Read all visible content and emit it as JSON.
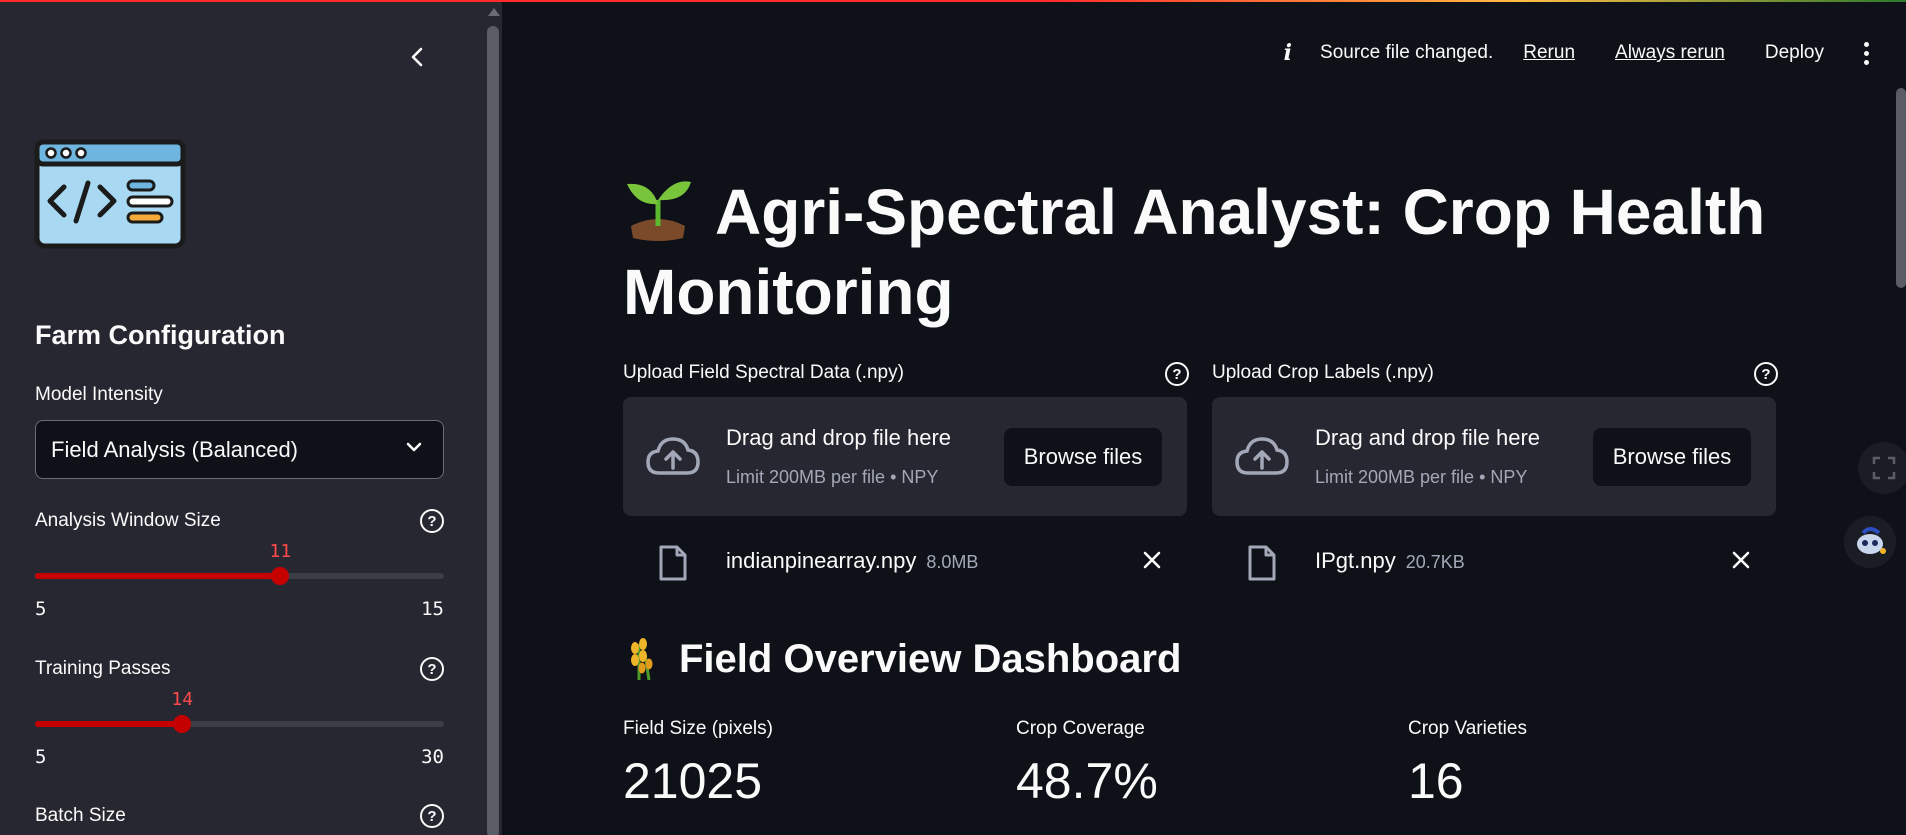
{
  "toolbar": {
    "info_icon": "info-icon",
    "status": "Source file changed.",
    "rerun": "Rerun",
    "always_rerun": "Always rerun",
    "deploy": "Deploy",
    "menu_icon": "vertical-dots-icon"
  },
  "sidebar": {
    "collapse_icon": "chevron-left-icon",
    "logo_icon": "code-window-icon",
    "heading": "Farm Configuration",
    "model_intensity": {
      "label": "Model Intensity",
      "value": "Field Analysis (Balanced)"
    },
    "window_size": {
      "label": "Analysis Window Size",
      "min": "5",
      "max": "15",
      "value": "11",
      "fraction": 0.6
    },
    "training_passes": {
      "label": "Training Passes",
      "min": "5",
      "max": "30",
      "value": "14",
      "fraction": 0.36
    },
    "batch_size": {
      "label": "Batch Size"
    }
  },
  "main": {
    "title": "Agri-Spectral Analyst: Crop Health Monitoring",
    "title_icon": "seedling-icon",
    "uploads": [
      {
        "label": "Upload Field Spectral Data (.npy)",
        "drop_text": "Drag and drop file here",
        "limit": "Limit 200MB per file • NPY",
        "browse": "Browse files",
        "file_name": "indianpinearray.npy",
        "file_size": "8.0MB"
      },
      {
        "label": "Upload Crop Labels (.npy)",
        "drop_text": "Drag and drop file here",
        "limit": "Limit 200MB per file • NPY",
        "browse": "Browse files",
        "file_name": "IPgt.npy",
        "file_size": "20.7KB"
      }
    ],
    "section_title": "Field Overview Dashboard",
    "section_icon": "wheat-icon",
    "metrics": [
      {
        "label": "Field Size (pixels)",
        "value": "21025"
      },
      {
        "label": "Crop Coverage",
        "value": "48.7%"
      },
      {
        "label": "Crop Varieties",
        "value": "16"
      }
    ]
  },
  "colors": {
    "background": "#0e1117",
    "sidebar": "#262730",
    "accent": "#c50000",
    "slider_value": "#ff4b4b"
  }
}
